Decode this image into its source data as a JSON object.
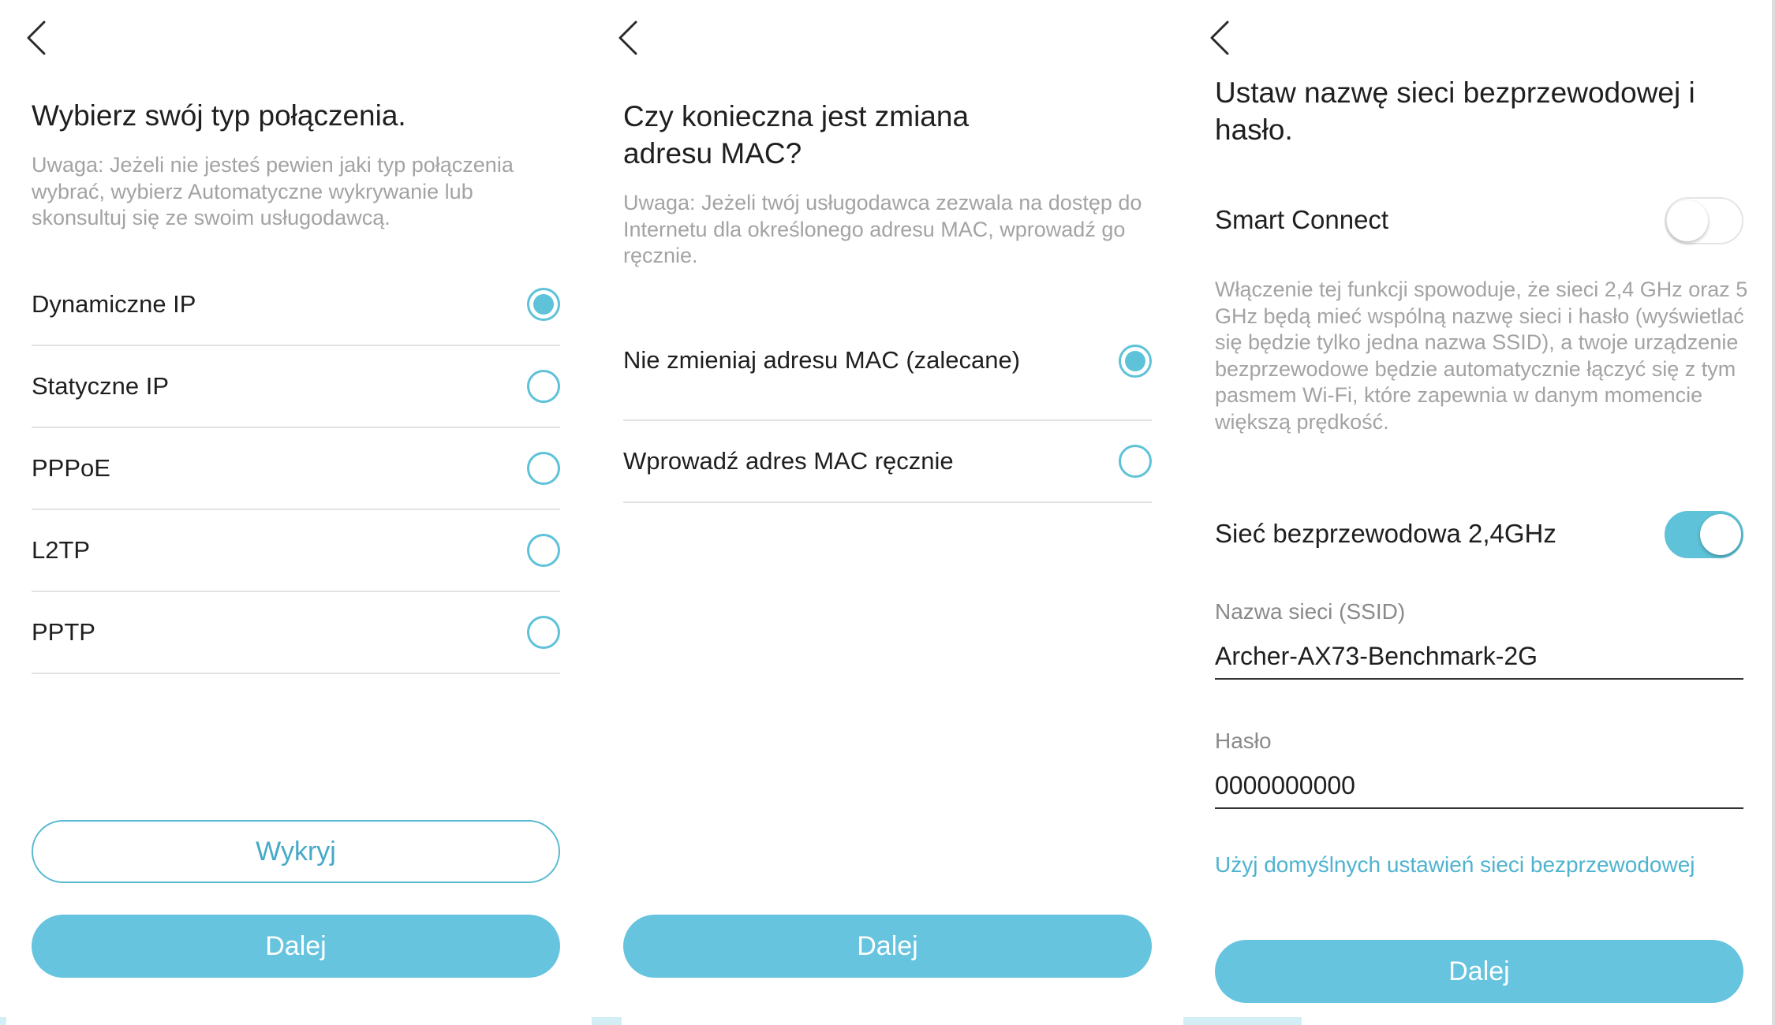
{
  "screens": {
    "connection_type": {
      "title": "Wybierz swój typ połączenia.",
      "note": "Uwaga: Jeżeli nie jesteś pewien jaki typ połączenia wybrać, wybierz Automatyczne wykrywanie lub skonsultuj się ze swoim usługodawcą.",
      "options": [
        {
          "label": "Dynamiczne IP",
          "selected": true
        },
        {
          "label": "Statyczne IP",
          "selected": false
        },
        {
          "label": "PPPoE",
          "selected": false
        },
        {
          "label": "L2TP",
          "selected": false
        },
        {
          "label": "PPTP",
          "selected": false
        }
      ],
      "detect_button": "Wykryj",
      "next_button": "Dalej"
    },
    "mac_address": {
      "title": "Czy konieczna jest zmiana adresu MAC?",
      "note": "Uwaga: Jeżeli twój usługodawca zezwala na dostęp do Internetu dla określonego adresu MAC, wprowadź go ręcznie.",
      "options": [
        {
          "label": "Nie zmieniaj adresu MAC (zalecane)",
          "selected": true
        },
        {
          "label": "Wprowadź adres MAC ręcznie",
          "selected": false
        }
      ],
      "next_button": "Dalej"
    },
    "wireless": {
      "title": "Ustaw nazwę sieci bezprzewodowej i hasło.",
      "smart_connect": {
        "label": "Smart Connect",
        "enabled": false
      },
      "smart_connect_note": "Włączenie tej funkcji spowoduje, że sieci 2,4 GHz oraz 5 GHz będą mieć wspólną nazwę sieci i hasło (wyświetlać się będzie tylko jedna nazwa SSID), a twoje urządzenie bezprzewodowe będzie automatycznie łączyć się z tym pasmem Wi-Fi, które zapewnia w danym momencie większą prędkość.",
      "band_24": {
        "label": "Sieć bezprzewodowa 2,4GHz",
        "enabled": true
      },
      "ssid": {
        "label": "Nazwa sieci (SSID)",
        "value": "Archer-AX73-Benchmark-2G"
      },
      "password": {
        "label": "Hasło",
        "value": "0000000000"
      },
      "default_link": "Użyj domyślnych ustawień sieci bezprzewodowej",
      "next_button": "Dalej"
    }
  },
  "colors": {
    "accent": "#5ec2d8",
    "button": "#66c4df",
    "link": "#4fb3cf",
    "text": "#1f1f1f",
    "muted": "#a3a3a3"
  },
  "icons": {
    "back": "chevron-left-icon"
  }
}
